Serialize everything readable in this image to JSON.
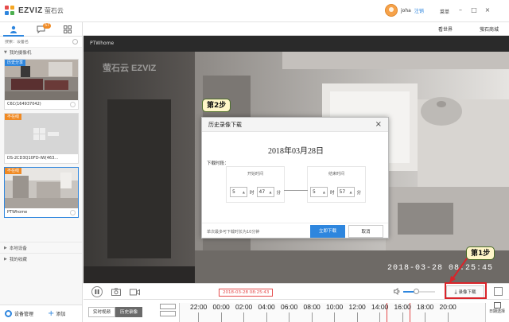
{
  "app": {
    "logo_text": "EZVIZ",
    "logo_cn": "萤石云",
    "username": "joha",
    "logout": "注销",
    "menu": "菜单"
  },
  "sidebar": {
    "search_placeholder": "搜索：设备名",
    "badge": "57",
    "group_label": "我的摄像机",
    "cameras": [
      {
        "tag": "历史分享",
        "name": "C6C(164937042)",
        "tag_color": "#2e86de"
      },
      {
        "tag": "不在线",
        "name": "DS-2CD3Q10FD-IW(463...",
        "tag_color": "#f08a24"
      },
      {
        "tag": "不在线",
        "name": "PTWhome",
        "tag_color": "#f08a24"
      }
    ],
    "local_devices": "本地设备",
    "my_favorites": "我的收藏",
    "device_manage": "设备管理",
    "add": "添加"
  },
  "topnav": {
    "world": "看世界",
    "mall": "萤石商城"
  },
  "video": {
    "title": "PTWhome",
    "watermark": "萤石云 EZVIZ",
    "osd_time": "2018-03-28 08:25:45"
  },
  "modal": {
    "title": "历史录像下载",
    "date": "2018年03月28日",
    "duration_label": "下载时段：",
    "start_caption": "开始时间",
    "end_caption": "结束时间",
    "start_hour": "5",
    "start_min": "47",
    "end_hour": "5",
    "end_min": "57",
    "hour_unit": "时",
    "min_unit": "分",
    "hint": "单次最多可下载时长为10分钟",
    "confirm": "立即下载",
    "cancel": "取消"
  },
  "player": {
    "record_download": "录像下载"
  },
  "timeline": {
    "live_tab": "实时视频",
    "history_tab": "历史录像",
    "current_stamp": "2018-03-28 08:25:43",
    "date_select": "日期选择",
    "times": [
      "22:00",
      "00:00",
      "02:00",
      "04:00",
      "06:00",
      "08:00",
      "10:00",
      "12:00",
      "14:00",
      "16:00",
      "18:00",
      "20:00"
    ]
  },
  "steps": {
    "step1": "第1步",
    "step2": "第2步"
  },
  "colors": {
    "accent": "#2e86de",
    "warning": "#f08a24",
    "highlight": "#d9242a",
    "callout": "#fff6c8"
  }
}
